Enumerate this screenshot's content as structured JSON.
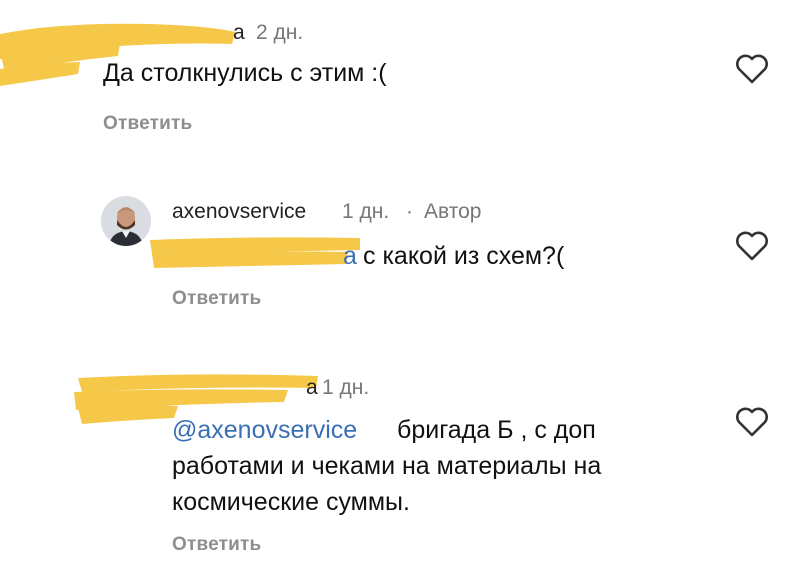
{
  "comments": [
    {
      "username_fragment": "а",
      "time": "2 дн.",
      "text": "Да столкнулись с этим :(",
      "reply_label": "Ответить"
    },
    {
      "username": "axenovservice",
      "time": "1 дн.",
      "separator": "·",
      "author_badge": "Автор",
      "mention_fragment": "а",
      "text": "с какой из схем?(",
      "reply_label": "Ответить"
    },
    {
      "username_fragment": "а",
      "time": "1 дн.",
      "mention": "@axenovservice",
      "text_line1": "бригада Б , с доп",
      "text_line2": "работами и чеками на материалы на",
      "text_line3": "космические суммы.",
      "reply_label": "Ответить"
    }
  ],
  "colors": {
    "highlight": "#f6c84a",
    "mention": "#3a6fb5",
    "meta": "#777777"
  }
}
